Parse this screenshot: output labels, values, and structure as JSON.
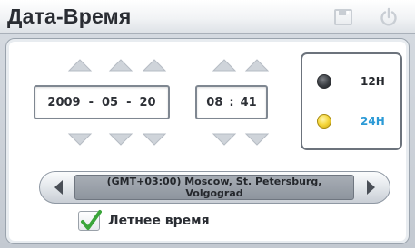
{
  "window": {
    "title": "Дата-Время",
    "icons": [
      "save-icon",
      "power-icon"
    ]
  },
  "date": {
    "year": "2009",
    "month": "05",
    "day": "20",
    "separator": "-"
  },
  "time": {
    "hour": "08",
    "minute": "41",
    "separator": ":"
  },
  "hour_format": {
    "options": [
      "12H",
      "24H"
    ],
    "selected": "24H"
  },
  "timezone": {
    "value": "(GMT+03:00) Moscow, St. Petersburg, Volgograd"
  },
  "daylight_saving": {
    "label": "Летнее время",
    "checked": true
  },
  "colors": {
    "accent_24h": "#2c9ad6",
    "check_green": "#3aa53a"
  }
}
